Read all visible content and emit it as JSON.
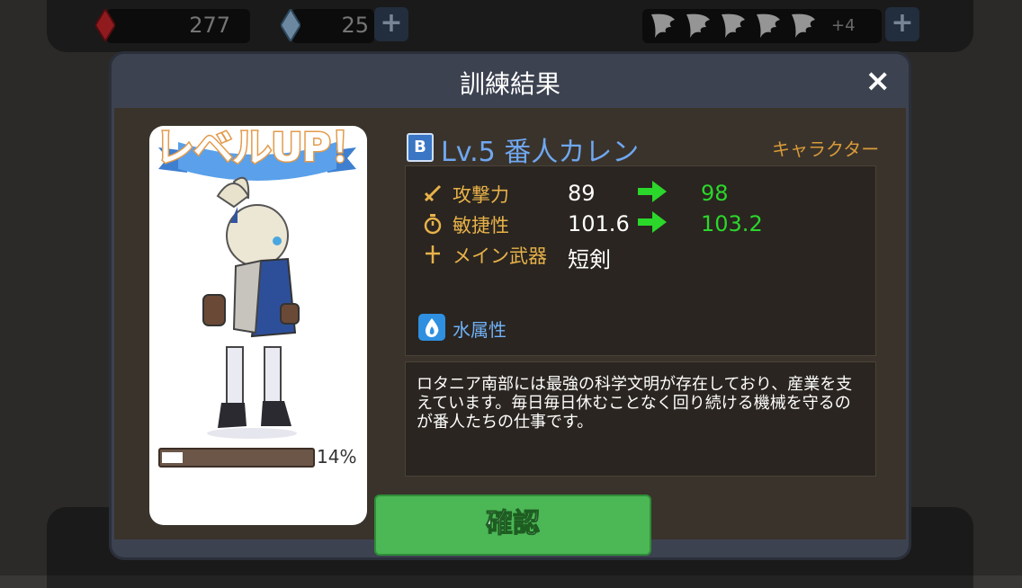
{
  "hud": {
    "red_gem_value": "277",
    "blue_gem_value": "25",
    "plus_label": "+",
    "wings_extra": "+4",
    "wing_count_icons": 5
  },
  "modal": {
    "title": "訓練結果",
    "close_label": "×",
    "confirm_label": "確認"
  },
  "card": {
    "levelup_text": "レベルUP！",
    "xp_percent": "14%",
    "xp_fraction": 0.14
  },
  "character": {
    "rank": "B",
    "name": "Lv.5 番人カレン",
    "type": "キャラクター",
    "element": "水属性"
  },
  "stats": [
    {
      "label": "攻撃力",
      "old": "89",
      "new": "98"
    },
    {
      "label": "敏捷性",
      "old": "101.6",
      "new": "103.2"
    },
    {
      "label": "メイン武器",
      "old": "短剣",
      "new": ""
    }
  ],
  "description": "ロタニア南部には最強の科学文明が存在しており、産業を支えています。毎日毎日休むことなく回り続ける機械を守るのが番人たちの仕事です。",
  "colors": {
    "accent_gold": "#e8b24a",
    "stat_new_green": "#2bd72b",
    "confirm_green": "#4cb755",
    "name_blue": "#6fa7f0"
  }
}
